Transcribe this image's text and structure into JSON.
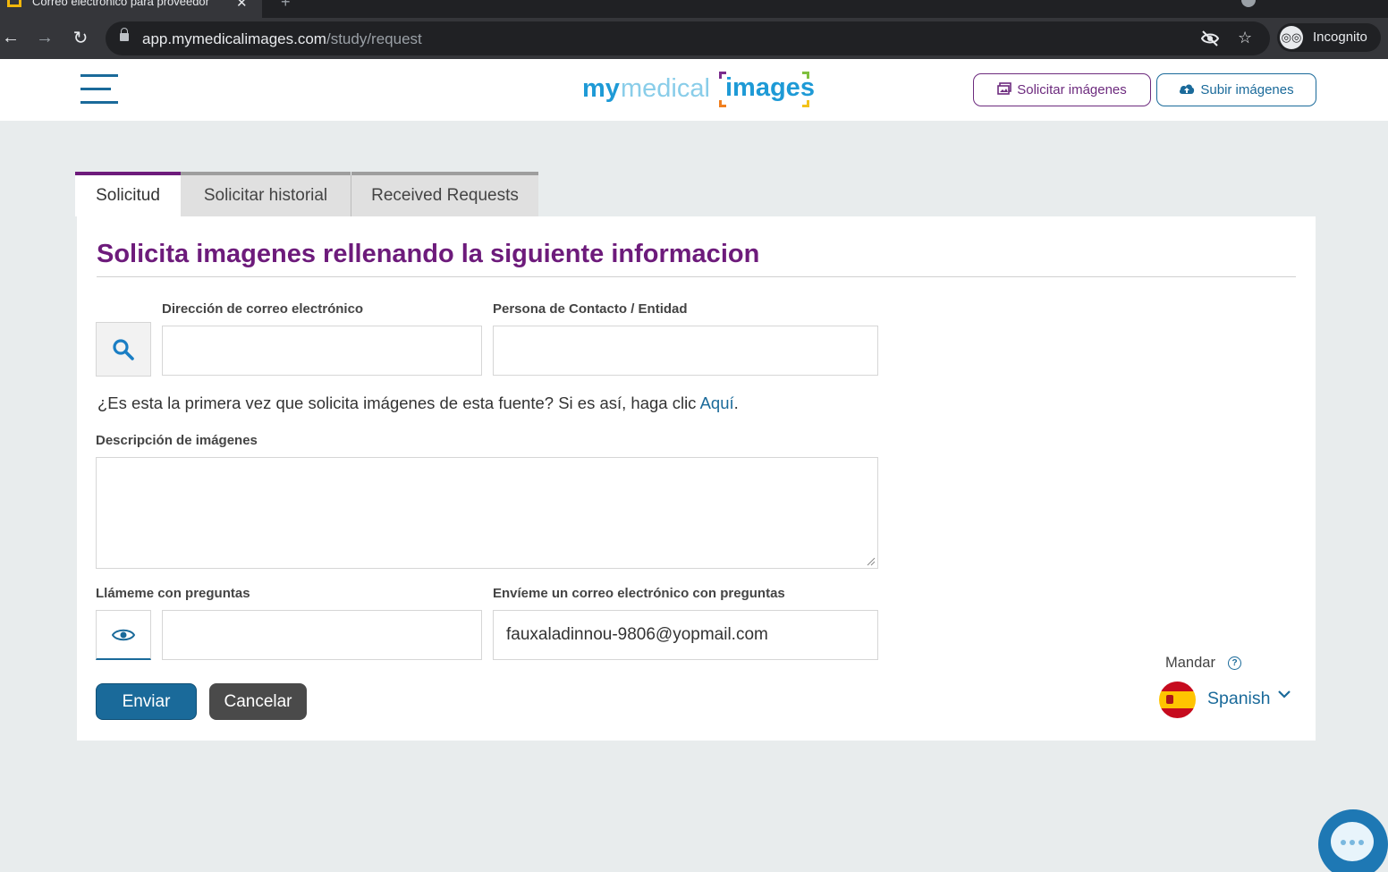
{
  "browser": {
    "tab_title": "Correo electrónico para proveedor",
    "url_host": "app.mymedicalimages.com",
    "url_path": "/study/request",
    "incognito_label": "Incognito"
  },
  "header": {
    "logo": {
      "my": "my",
      "medical": "medical",
      "images": "images"
    },
    "request_button": "Solicitar imágenes",
    "upload_button": "Subir imágenes"
  },
  "tabs": [
    {
      "label": "Solicitud",
      "active": true
    },
    {
      "label": "Solicitar historial",
      "active": false
    },
    {
      "label": "Received Requests",
      "active": false
    }
  ],
  "form": {
    "title": "Solicita imagenes rellenando la siguiente informacion",
    "email_label": "Dirección de correo electrónico",
    "email_value": "",
    "contact_label": "Persona de Contacto / Entidad",
    "contact_value": "",
    "first_time_text": "¿Es esta la primera vez que solicita imágenes de esta fuente? Si es así, haga clic ",
    "first_time_link": "Aquí",
    "first_time_end": ".",
    "description_label": "Descripción de imágenes",
    "description_value": "",
    "call_label": "Llámeme con preguntas",
    "call_value": "",
    "email_questions_label": "Envíeme un correo electrónico con preguntas",
    "email_questions_value": "fauxaladinnou-9806@yopmail.com",
    "submit_label": "Enviar",
    "cancel_label": "Cancelar"
  },
  "language": {
    "send_label": "Mandar",
    "selected": "Spanish"
  },
  "colors": {
    "brand_purple": "#6d1b7b",
    "brand_blue": "#1a6a9a",
    "logo_blue": "#1e9ad6"
  }
}
